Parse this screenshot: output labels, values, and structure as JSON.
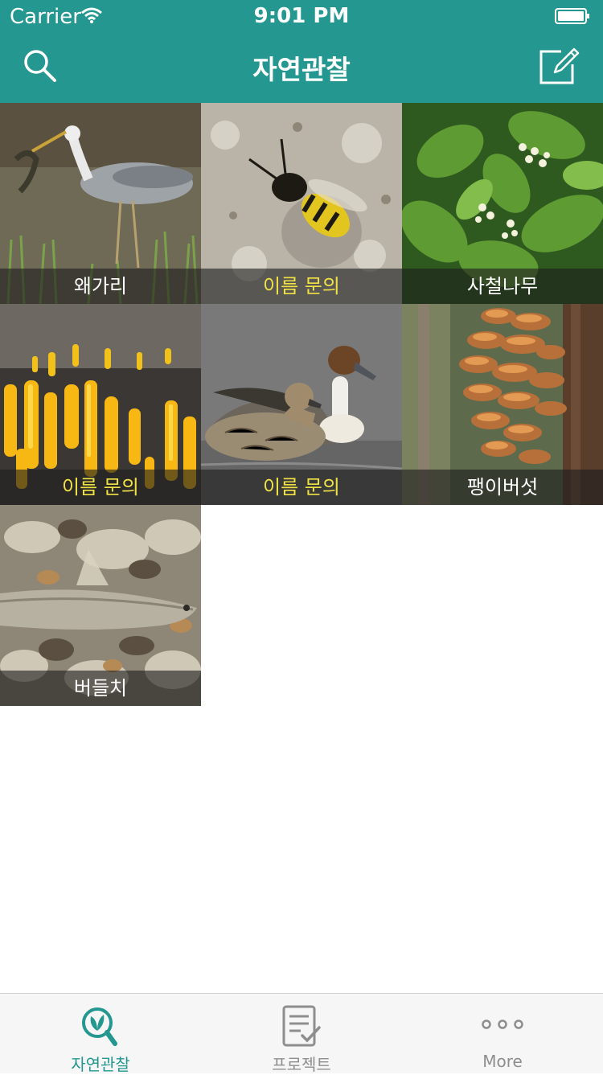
{
  "status_bar": {
    "carrier": "Carrier",
    "time": "9:01 PM"
  },
  "nav": {
    "title": "자연관찰",
    "search_icon": "search-icon",
    "compose_icon": "compose-icon"
  },
  "colors": {
    "header": "#239790",
    "inquiry_text": "#f1e244",
    "tab_active": "#239790",
    "tab_inactive": "#8e8e8e"
  },
  "observations": [
    {
      "label": "왜가리",
      "state": "named",
      "image": "heron"
    },
    {
      "label": "이름 문의",
      "state": "inquiry",
      "image": "wasp"
    },
    {
      "label": "사철나무",
      "state": "named",
      "image": "leaves"
    },
    {
      "label": "이름 문의",
      "state": "inquiry",
      "image": "yellow-fungus"
    },
    {
      "label": "이름 문의",
      "state": "inquiry",
      "image": "ducks"
    },
    {
      "label": "팽이버섯",
      "state": "named",
      "image": "mushrooms"
    },
    {
      "label": "버들치",
      "state": "named",
      "image": "fish"
    }
  ],
  "tabbar": {
    "items": [
      {
        "label": "자연관찰",
        "icon": "nature-search-icon",
        "active": true
      },
      {
        "label": "프로젝트",
        "icon": "checklist-icon",
        "active": false
      },
      {
        "label": "More",
        "icon": "more-dots-icon",
        "active": false
      }
    ]
  }
}
